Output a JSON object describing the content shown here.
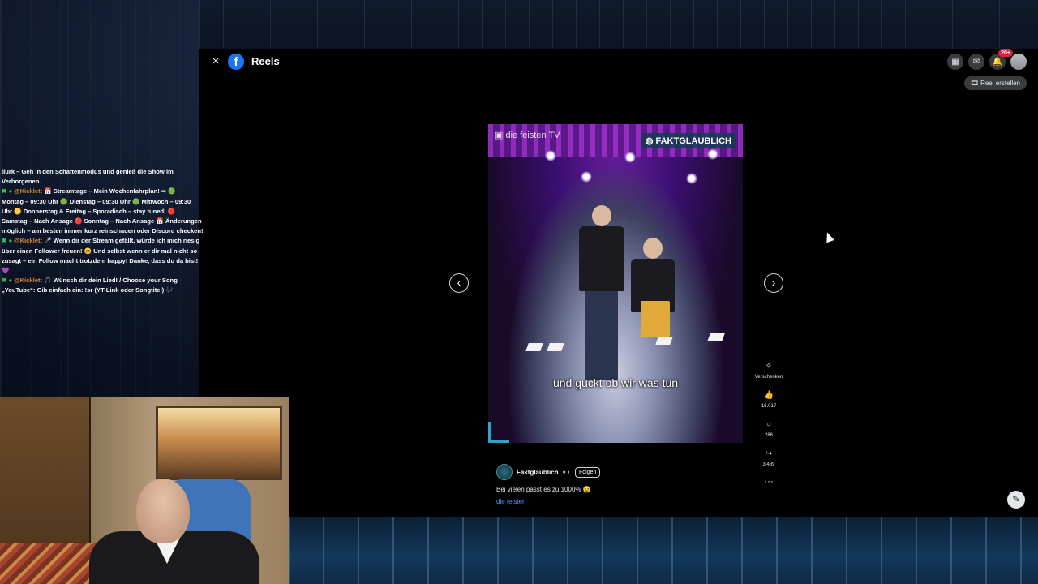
{
  "header": {
    "close_icon": "×",
    "logo_letter": "f",
    "title": "Reels",
    "notifications_badge": "20+",
    "create_reel_label": "Reel erstellen"
  },
  "video": {
    "watermark_left": "die feisten TV",
    "watermark_right": "FAKTGLAUBLICH",
    "subtitle": "und guckt ob wir was tun"
  },
  "actions": {
    "gift_label": "Verschenken",
    "likes": "16.017",
    "comments": "286",
    "shares": "3.489",
    "more": "···"
  },
  "post": {
    "author": "Faktglaublich",
    "follow_label": "Folgen",
    "caption": "Bei vielen passt es zu 1000% 😉",
    "hashtag": "die feisten"
  },
  "chat": {
    "lines": [
      {
        "user": "",
        "text": "llurk – Geh in den Schattenmodus und genieß die Show im"
      },
      {
        "user": "",
        "text": "Verborgenen."
      },
      {
        "user": "@Kicklet",
        "text": ": 📅 Streamtage – Mein Wochenfahrplan! ➡ 🟢"
      },
      {
        "user": "",
        "text": "Montag – 09:30 Uhr 🟢 Dienstag – 09:30 Uhr 🟢 Mittwoch – 09:30"
      },
      {
        "user": "",
        "text": "Uhr 🟡 Donnerstag & Freitag – Sporadisch – stay tuned! 🔴"
      },
      {
        "user": "",
        "text": "Samstag – Nach Ansage 🔴 Sonntag – Nach Ansage 📅 Änderungen"
      },
      {
        "user": "",
        "text": "möglich – am besten immer kurz reinschauen oder Discord checken!"
      },
      {
        "user": "@Kicklet",
        "text": ": 🎤 Wenn dir der Stream gefällt, würde ich mich riesig"
      },
      {
        "user": "",
        "text": "über einen Follower freuen! 😊 Und selbst wenn er dir mal nicht so"
      },
      {
        "user": "",
        "text": "zusagt – ein Follow macht trotzdem happy! Danke, dass du da bist!"
      },
      {
        "user": "",
        "text": "💜"
      },
      {
        "user": "@Kicklet",
        "text": ": 🎵 Wünsch dir dein Lied! / Choose your Song"
      },
      {
        "user": "",
        "text": "„YouTube“: Gib einfach ein: !sr (YT-Link oder Songtitel) 🎶"
      }
    ]
  },
  "colors": {
    "facebook_blue": "#1877f2",
    "link_blue": "#4599ff",
    "chat_user": "#d58b2f"
  }
}
